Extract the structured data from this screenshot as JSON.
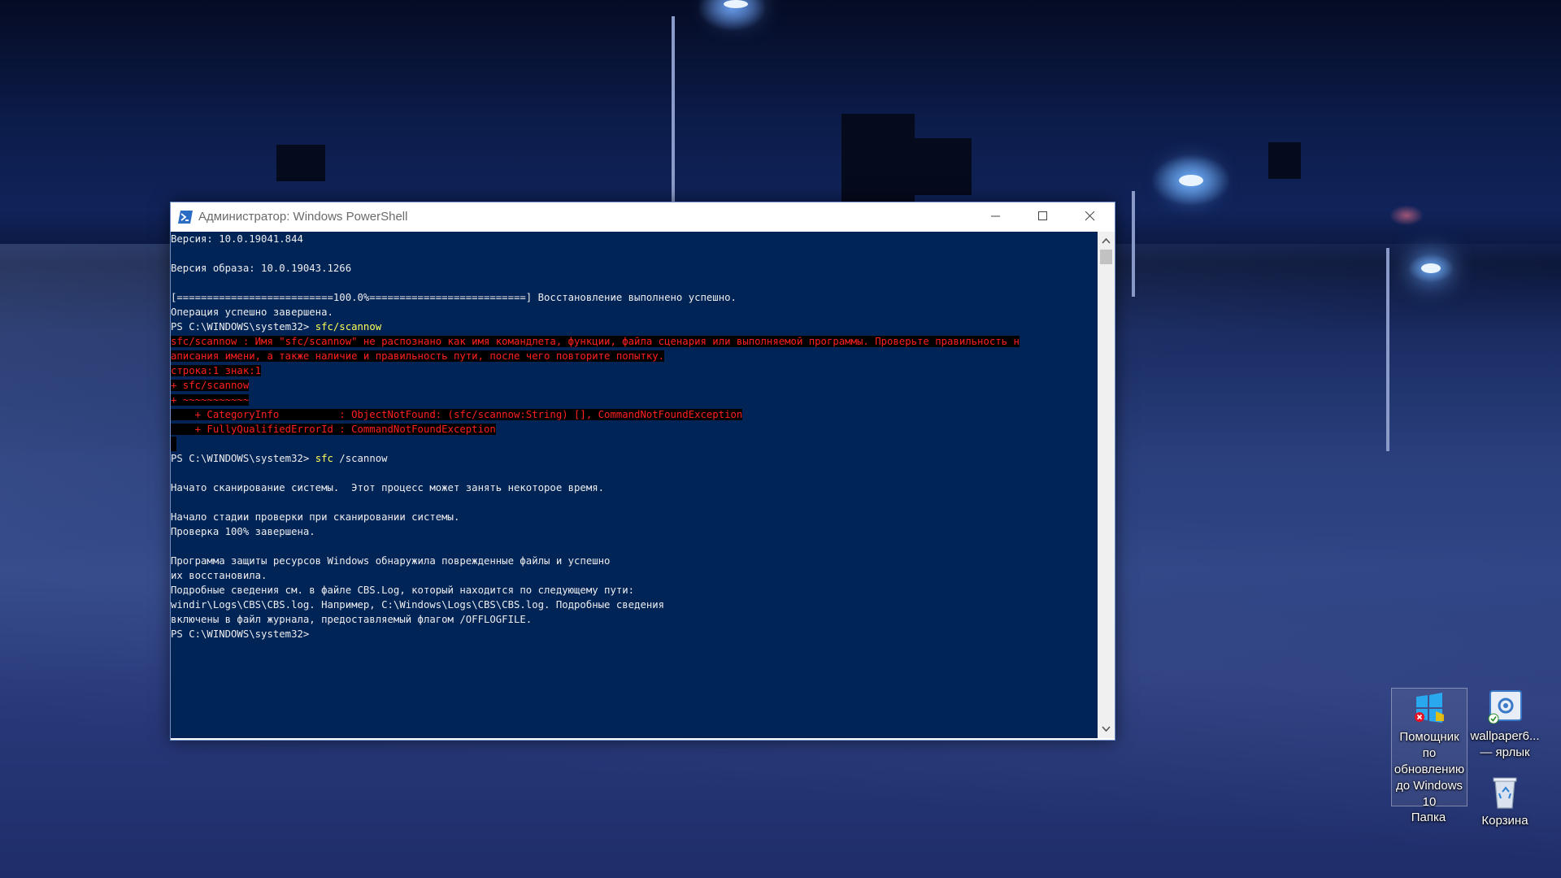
{
  "window": {
    "title": "Администратор: Windows PowerShell"
  },
  "console": {
    "lines": [
      {
        "text": "Версия: 10.0.19041.844",
        "style": "normal"
      },
      {
        "text": "",
        "style": "normal"
      },
      {
        "text": "Версия образа: 10.0.19043.1266",
        "style": "normal"
      },
      {
        "text": "",
        "style": "normal"
      },
      {
        "text": "[==========================100.0%==========================] Восстановление выполнено успешно.",
        "style": "normal"
      },
      {
        "text": "Операция успешно завершена.",
        "style": "normal"
      },
      {
        "prompt": "PS C:\\WINDOWS\\system32> ",
        "cmd": "sfc/scannow",
        "rest": "",
        "style": "command"
      },
      {
        "text": "sfc/scannow : Имя \"sfc/scannow\" не распознано как имя командлета, функции, файла сценария или выполняемой программы. Проверьте правильность н",
        "style": "error"
      },
      {
        "text": "аписания имени, а также наличие и правильность пути, после чего повторите попытку.",
        "style": "error"
      },
      {
        "text": "строка:1 знак:1",
        "style": "error"
      },
      {
        "text": "+ sfc/scannow",
        "style": "error"
      },
      {
        "text": "+ ~~~~~~~~~~~",
        "style": "error"
      },
      {
        "text": "    + CategoryInfo          : ObjectNotFound: (sfc/scannow:String) [], CommandNotFoundException",
        "style": "error"
      },
      {
        "text": "    + FullyQualifiedErrorId : CommandNotFoundException",
        "style": "error"
      },
      {
        "text": "",
        "style": "errspacer"
      },
      {
        "prompt": "PS C:\\WINDOWS\\system32> ",
        "cmd": "sfc",
        "rest": " /scannow",
        "style": "command"
      },
      {
        "text": "",
        "style": "normal"
      },
      {
        "text": "Начато сканирование системы.  Этот процесс может занять некоторое время.",
        "style": "normal"
      },
      {
        "text": "",
        "style": "normal"
      },
      {
        "text": "Начало стадии проверки при сканировании системы.",
        "style": "normal"
      },
      {
        "text": "Проверка 100% завершена.",
        "style": "normal"
      },
      {
        "text": "",
        "style": "normal"
      },
      {
        "text": "Программа защиты ресурсов Windows обнаружила поврежденные файлы и успешно",
        "style": "normal"
      },
      {
        "text": "их восстановила.",
        "style": "normal"
      },
      {
        "text": "Подробные сведения см. в файле CBS.Log, который находится по следующему пути:",
        "style": "normal"
      },
      {
        "text": "windir\\Logs\\CBS\\CBS.log. Например, C:\\Windows\\Logs\\CBS\\CBS.log. Подробные сведения",
        "style": "normal"
      },
      {
        "text": "включены в файл журнала, предоставляемый флагом /OFFLOGFILE.",
        "style": "normal"
      },
      {
        "text": "PS C:\\WINDOWS\\system32>",
        "style": "normal"
      }
    ]
  },
  "desktop": {
    "icons": [
      {
        "id": "update-assistant",
        "label": "Помощник по обновлению до Windows 10",
        "icon": "windows-logo-icon"
      },
      {
        "id": "wallpaper-shortcut",
        "label": "wallpaper6... — ярлык",
        "icon": "wallpaper-engine-icon"
      },
      {
        "id": "folder",
        "label": "Папка",
        "icon": "folder-icon"
      },
      {
        "id": "recycle-bin",
        "label": "Корзина",
        "icon": "recycle-bin-icon"
      }
    ]
  },
  "colors": {
    "console_bg": "#012456",
    "console_text": "#eeedf0",
    "error_text": "#ff2020",
    "command_text": "#ffff55"
  }
}
